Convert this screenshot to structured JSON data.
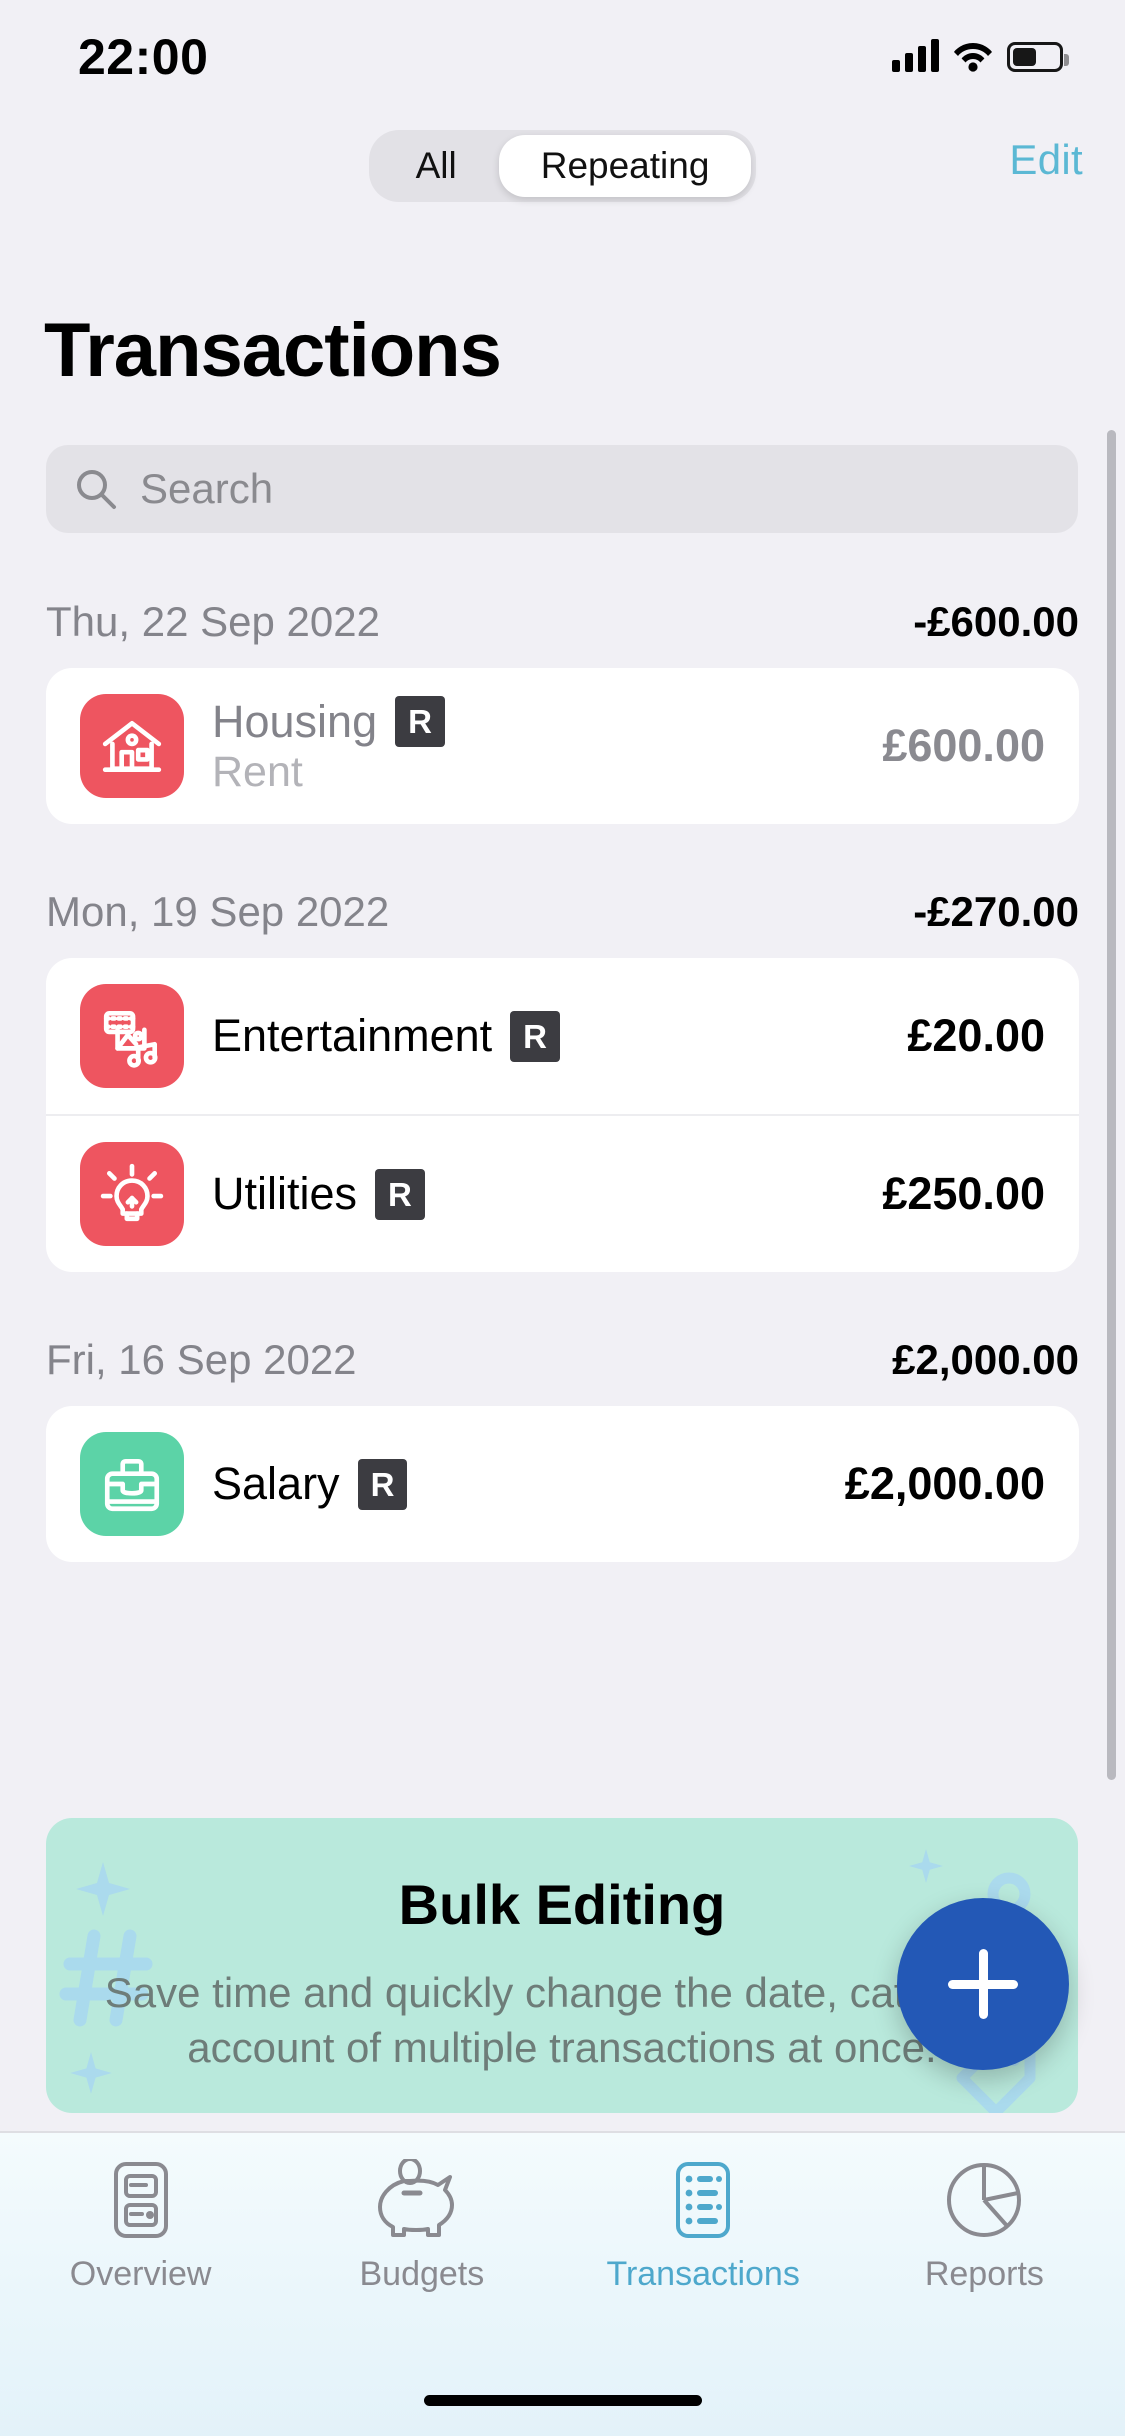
{
  "status_bar": {
    "time": "22:00",
    "battery_percent": 45
  },
  "header": {
    "segments": [
      {
        "label": "All",
        "active": false
      },
      {
        "label": "Repeating",
        "active": true
      }
    ],
    "edit_label": "Edit",
    "title": "Transactions",
    "accent_color": "#5BB8D4"
  },
  "search": {
    "placeholder": "Search",
    "value": ""
  },
  "groups": [
    {
      "date": "Thu, 22 Sep 2022",
      "total": "-£600.00",
      "rows": [
        {
          "title": "Housing",
          "subtitle": "Rent",
          "badge": "R",
          "amount": "£600.00",
          "icon": "house-icon",
          "icon_color": "#EE5560",
          "title_muted": true,
          "amount_muted": true
        }
      ]
    },
    {
      "date": "Mon, 19 Sep 2022",
      "total": "-£270.00",
      "rows": [
        {
          "title": "Entertainment",
          "subtitle": "",
          "badge": "R",
          "amount": "£20.00",
          "icon": "media-icon",
          "icon_color": "#EE5560",
          "title_muted": false,
          "amount_muted": false
        },
        {
          "title": "Utilities",
          "subtitle": "",
          "badge": "R",
          "amount": "£250.00",
          "icon": "lightbulb-icon",
          "icon_color": "#EE5560",
          "title_muted": false,
          "amount_muted": false
        }
      ]
    },
    {
      "date": "Fri, 16 Sep 2022",
      "total": "£2,000.00",
      "rows": [
        {
          "title": "Salary",
          "subtitle": "",
          "badge": "R",
          "amount": "£2,000.00",
          "icon": "briefcase-icon",
          "icon_color": "#5CD3A7",
          "title_muted": false,
          "amount_muted": false
        }
      ]
    }
  ],
  "promo": {
    "title": "Bulk Editing",
    "body": "Save time and quickly change the date, category, account of multiple transactions at once.",
    "background_color": "#B9E9DC"
  },
  "fab": {
    "icon": "plus-icon",
    "color": "#2358B6"
  },
  "tabs": [
    {
      "label": "Overview",
      "icon": "overview-icon",
      "active": false
    },
    {
      "label": "Budgets",
      "icon": "piggy-bank-icon",
      "active": false
    },
    {
      "label": "Transactions",
      "icon": "transactions-list-icon",
      "active": true
    },
    {
      "label": "Reports",
      "icon": "pie-chart-icon",
      "active": false
    }
  ]
}
